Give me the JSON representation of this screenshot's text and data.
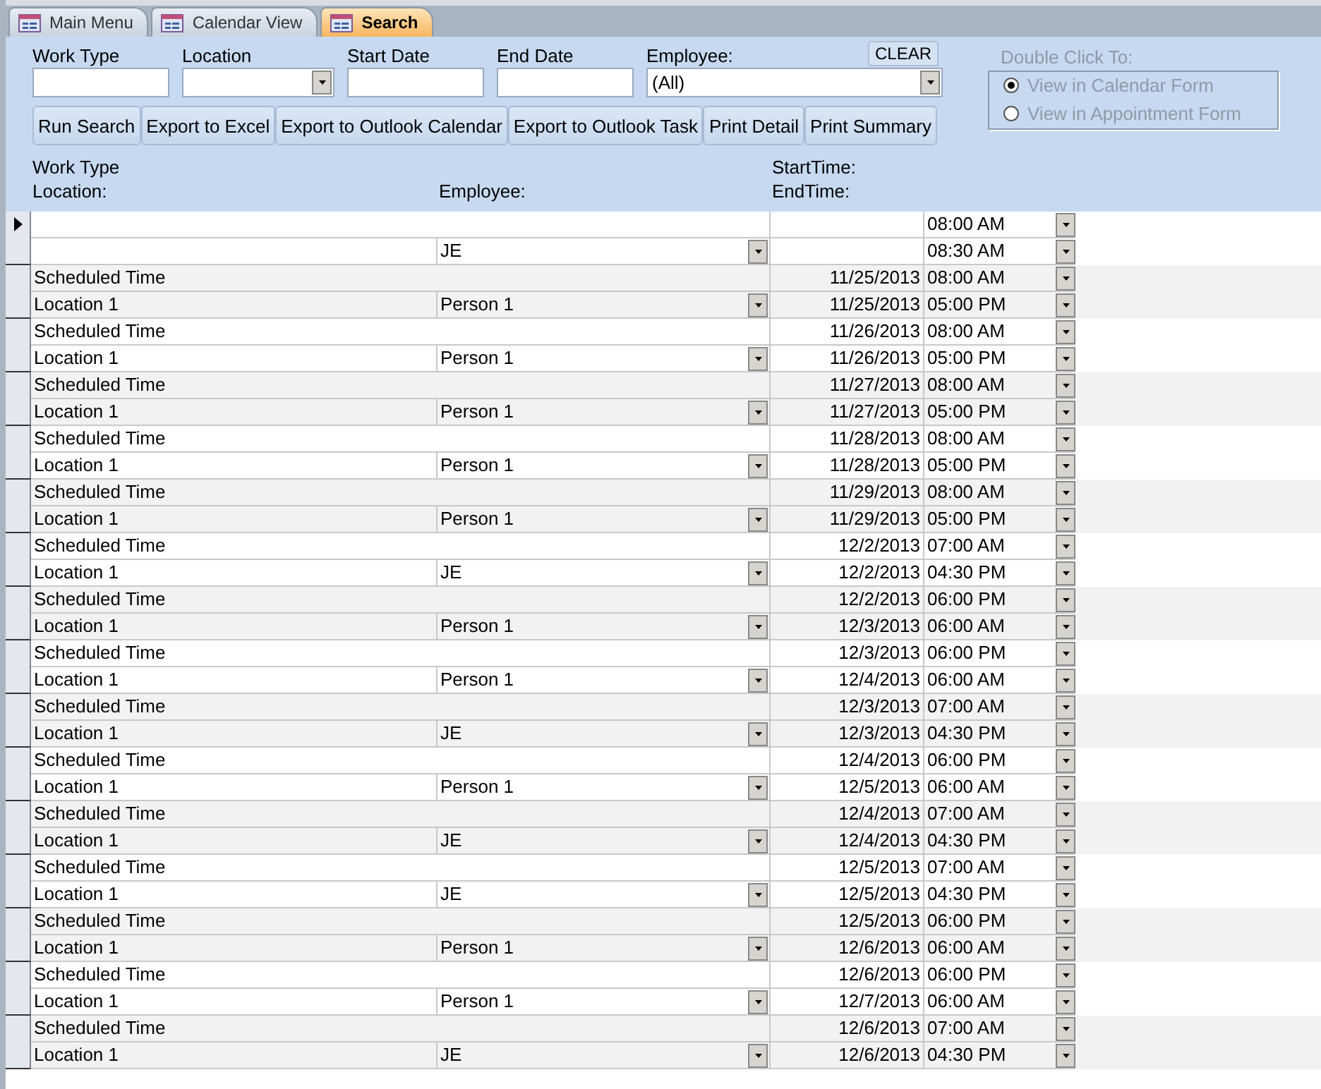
{
  "tabs": [
    {
      "label": "Main Menu",
      "selected": false
    },
    {
      "label": "Calendar View",
      "selected": false
    },
    {
      "label": "Search",
      "selected": true
    }
  ],
  "filters": [
    {
      "label": "Work Type",
      "kind": "text"
    },
    {
      "label": "Location",
      "kind": "combo"
    },
    {
      "label": "Start Date",
      "kind": "text"
    },
    {
      "label": "End Date",
      "kind": "text"
    },
    {
      "label": "Employee:",
      "kind": "combo",
      "value": "(All)"
    }
  ],
  "clear_button": "CLEAR",
  "buttons": [
    "Run Search",
    "Export to Excel",
    "Export to Outlook Calendar",
    "Export to Outlook Task",
    "Print Detail",
    "Print Summary"
  ],
  "double_click": {
    "title": "Double Click To:",
    "disabled": true,
    "options": [
      {
        "label": "View in Calendar Form",
        "selected": true
      },
      {
        "label": "View in Appointment Form",
        "selected": false
      }
    ]
  },
  "column_headers": {
    "work_type": "Work Type",
    "location": "Location:",
    "employee": "Employee:",
    "start_time": "StartTime:",
    "end_time": "EndTime:"
  },
  "records": [
    {
      "current": true,
      "start_time": "08:00 AM",
      "employee": "JE",
      "end_time": "08:30 AM"
    },
    {
      "current": false,
      "work_type": "Scheduled Time",
      "start_date": "11/25/2013",
      "start_time": "08:00 AM",
      "location": "Location 1",
      "employee": "Person 1",
      "end_date": "11/25/2013",
      "end_time": "05:00 PM"
    },
    {
      "current": false,
      "work_type": "Scheduled Time",
      "start_date": "11/26/2013",
      "start_time": "08:00 AM",
      "location": "Location 1",
      "employee": "Person 1",
      "end_date": "11/26/2013",
      "end_time": "05:00 PM"
    },
    {
      "current": false,
      "work_type": "Scheduled Time",
      "start_date": "11/27/2013",
      "start_time": "08:00 AM",
      "location": "Location 1",
      "employee": "Person 1",
      "end_date": "11/27/2013",
      "end_time": "05:00 PM"
    },
    {
      "current": false,
      "work_type": "Scheduled Time",
      "start_date": "11/28/2013",
      "start_time": "08:00 AM",
      "location": "Location 1",
      "employee": "Person 1",
      "end_date": "11/28/2013",
      "end_time": "05:00 PM"
    },
    {
      "current": false,
      "work_type": "Scheduled Time",
      "start_date": "11/29/2013",
      "start_time": "08:00 AM",
      "location": "Location 1",
      "employee": "Person 1",
      "end_date": "11/29/2013",
      "end_time": "05:00 PM"
    },
    {
      "current": false,
      "work_type": "Scheduled Time",
      "start_date": "12/2/2013",
      "start_time": "07:00 AM",
      "location": "Location 1",
      "employee": "JE",
      "end_date": "12/2/2013",
      "end_time": "04:30 PM"
    },
    {
      "current": false,
      "work_type": "Scheduled Time",
      "start_date": "12/2/2013",
      "start_time": "06:00 PM",
      "location": "Location 1",
      "employee": "Person 1",
      "end_date": "12/3/2013",
      "end_time": "06:00 AM"
    },
    {
      "current": false,
      "work_type": "Scheduled Time",
      "start_date": "12/3/2013",
      "start_time": "06:00 PM",
      "location": "Location 1",
      "employee": "Person 1",
      "end_date": "12/4/2013",
      "end_time": "06:00 AM"
    },
    {
      "current": false,
      "work_type": "Scheduled Time",
      "start_date": "12/3/2013",
      "start_time": "07:00 AM",
      "location": "Location 1",
      "employee": "JE",
      "end_date": "12/3/2013",
      "end_time": "04:30 PM"
    },
    {
      "current": false,
      "work_type": "Scheduled Time",
      "start_date": "12/4/2013",
      "start_time": "06:00 PM",
      "location": "Location 1",
      "employee": "Person 1",
      "end_date": "12/5/2013",
      "end_time": "06:00 AM"
    },
    {
      "current": false,
      "work_type": "Scheduled Time",
      "start_date": "12/4/2013",
      "start_time": "07:00 AM",
      "location": "Location 1",
      "employee": "JE",
      "end_date": "12/4/2013",
      "end_time": "04:30 PM"
    },
    {
      "current": false,
      "work_type": "Scheduled Time",
      "start_date": "12/5/2013",
      "start_time": "07:00 AM",
      "location": "Location 1",
      "employee": "JE",
      "end_date": "12/5/2013",
      "end_time": "04:30 PM"
    },
    {
      "current": false,
      "work_type": "Scheduled Time",
      "start_date": "12/5/2013",
      "start_time": "06:00 PM",
      "location": "Location 1",
      "employee": "Person 1",
      "end_date": "12/6/2013",
      "end_time": "06:00 AM"
    },
    {
      "current": false,
      "work_type": "Scheduled Time",
      "start_date": "12/6/2013",
      "start_time": "06:00 PM",
      "location": "Location 1",
      "employee": "Person 1",
      "end_date": "12/7/2013",
      "end_time": "06:00 AM"
    },
    {
      "current": false,
      "work_type": "Scheduled Time",
      "start_date": "12/6/2013",
      "start_time": "07:00 AM",
      "location": "Location 1",
      "employee": "JE",
      "end_date": "12/6/2013",
      "end_time": "04:30 PM"
    }
  ]
}
